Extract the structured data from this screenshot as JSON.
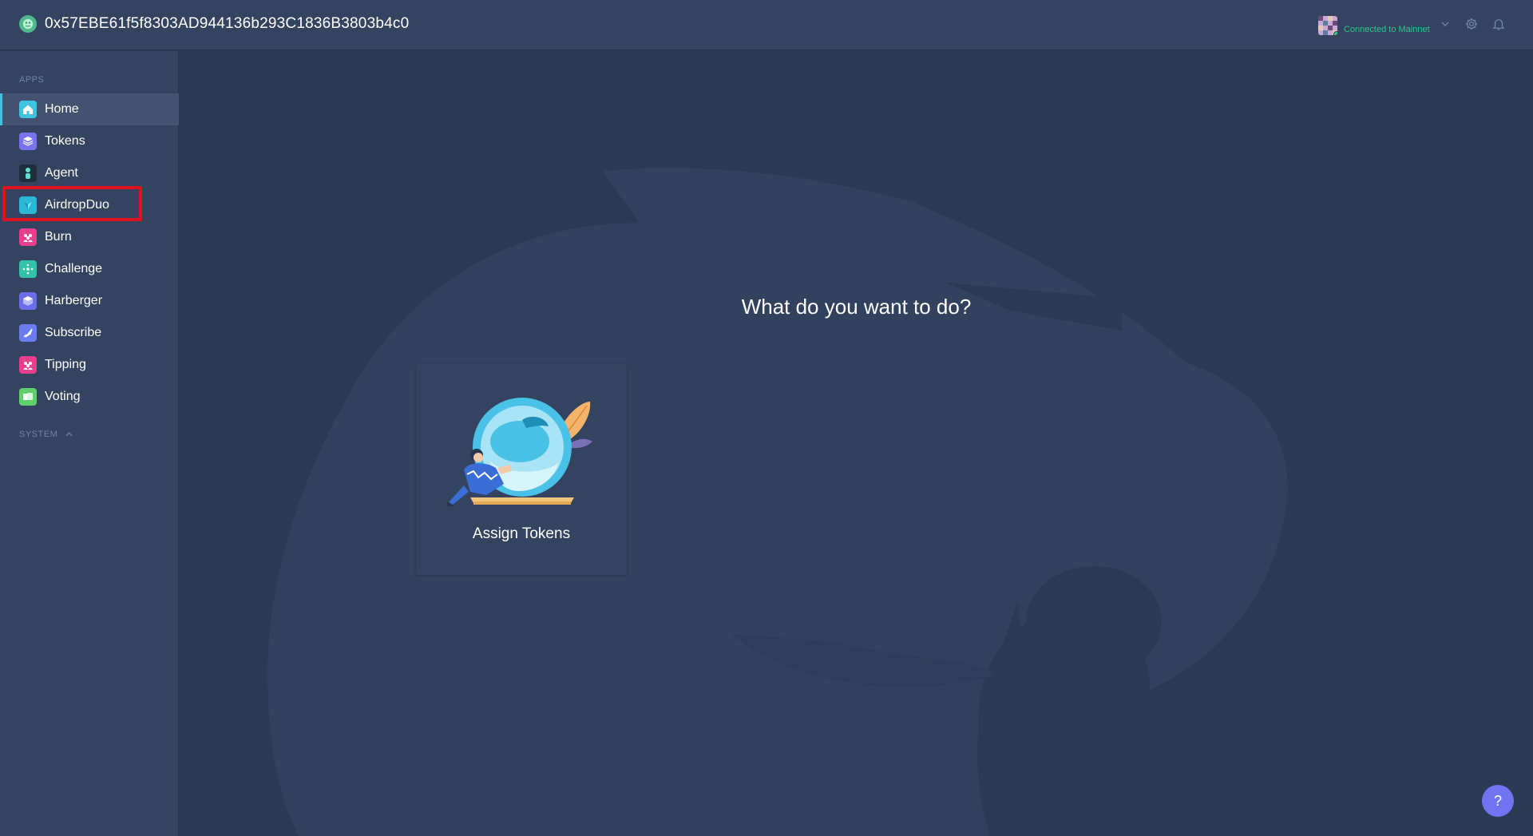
{
  "header": {
    "org_address": "0x57EBE61f5f8303AD944136b293C1836B3803b4c0",
    "account_status": "Connected to Mainnet",
    "settings_icon": "gear-icon",
    "notifications_icon": "bell-icon",
    "status_color": "#2cc68f"
  },
  "sidebar": {
    "apps_label": "APPS",
    "system_label": "SYSTEM",
    "items": [
      {
        "label": "Home",
        "icon": "home-icon",
        "color": "#3ec4e2",
        "active": true
      },
      {
        "label": "Tokens",
        "icon": "tokens-icon",
        "color": "#7a73f0",
        "active": false
      },
      {
        "label": "Agent",
        "icon": "agent-icon",
        "color": "#1f2d3d",
        "active": false
      },
      {
        "label": "AirdropDuo",
        "icon": "airdrop-icon",
        "color": "#2bb7d6",
        "active": false
      },
      {
        "label": "Burn",
        "icon": "burn-icon",
        "color": "#e83e8c",
        "active": false
      },
      {
        "label": "Challenge",
        "icon": "challenge-icon",
        "color": "#33c1a8",
        "active": false
      },
      {
        "label": "Harberger",
        "icon": "harberger-icon",
        "color": "#6a6ee8",
        "active": false
      },
      {
        "label": "Subscribe",
        "icon": "subscribe-icon",
        "color": "#6a7cf0",
        "active": false
      },
      {
        "label": "Tipping",
        "icon": "tipping-icon",
        "color": "#e83e8c",
        "active": false
      },
      {
        "label": "Voting",
        "icon": "voting-icon",
        "color": "#5fcf6a",
        "active": false
      }
    ],
    "highlight_color": "#e0101f"
  },
  "main": {
    "title": "What do you want to do?",
    "card_label": "Assign Tokens"
  },
  "help": {
    "label": "?",
    "color": "#7074f0"
  }
}
